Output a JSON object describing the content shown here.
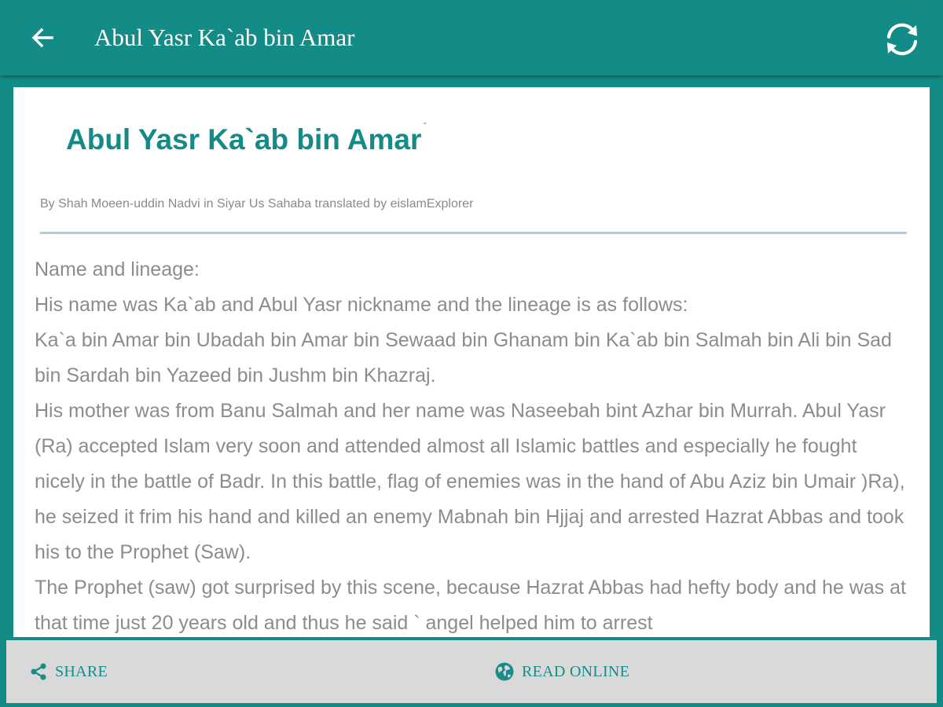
{
  "appbar": {
    "title": "Abul Yasr Ka`ab bin Amar",
    "back_icon": "arrow-left-icon",
    "refresh_icon": "refresh-icon"
  },
  "article": {
    "title": "Abul Yasr Ka`ab bin Amar",
    "title_mark": "ؓ",
    "byline": "By Shah Moeen-uddin Nadvi in Siyar Us Sahaba translated by eislamExplorer",
    "paragraphs": [
      "Name and lineage:",
      "His name was Ka`ab and Abul Yasr nickname and the lineage is as follows:",
      "Ka`a bin Amar bin Ubadah bin Amar bin Sewaad bin Ghanam bin Ka`ab bin Salmah bin Ali bin Sad bin Sardah bin Yazeed bin Jushm bin Khazraj.",
      "His mother was from Banu Salmah and her name was Naseebah bint Azhar bin Murrah. Abul Yasr (Ra) accepted Islam very soon and attended almost all Islamic battles and especially he fought nicely in the battle of Badr. In this battle, flag of enemies was in the hand of Abu Aziz bin Umair )Ra), he seized it frim his hand and killed an enemy Mabnah bin Hjjaj and arrested Hazrat Abbas and took his to the Prophet (Saw).",
      "The Prophet (saw) got surprised by this scene, because Hazrat Abbas had hefty body and he was at that time just 20 years old and thus he said ` angel helped him to arrest"
    ]
  },
  "bottombar": {
    "share_label": "SHARE",
    "share_icon": "share-icon",
    "read_online_label": "READ ONLINE",
    "read_online_icon": "globe-icon"
  },
  "colors": {
    "primary": "#138c87",
    "title_text": "#158a86",
    "body_text": "#8c8c8c",
    "divider": "#a9d2d8",
    "bottombar_bg": "#d9d9d9"
  }
}
